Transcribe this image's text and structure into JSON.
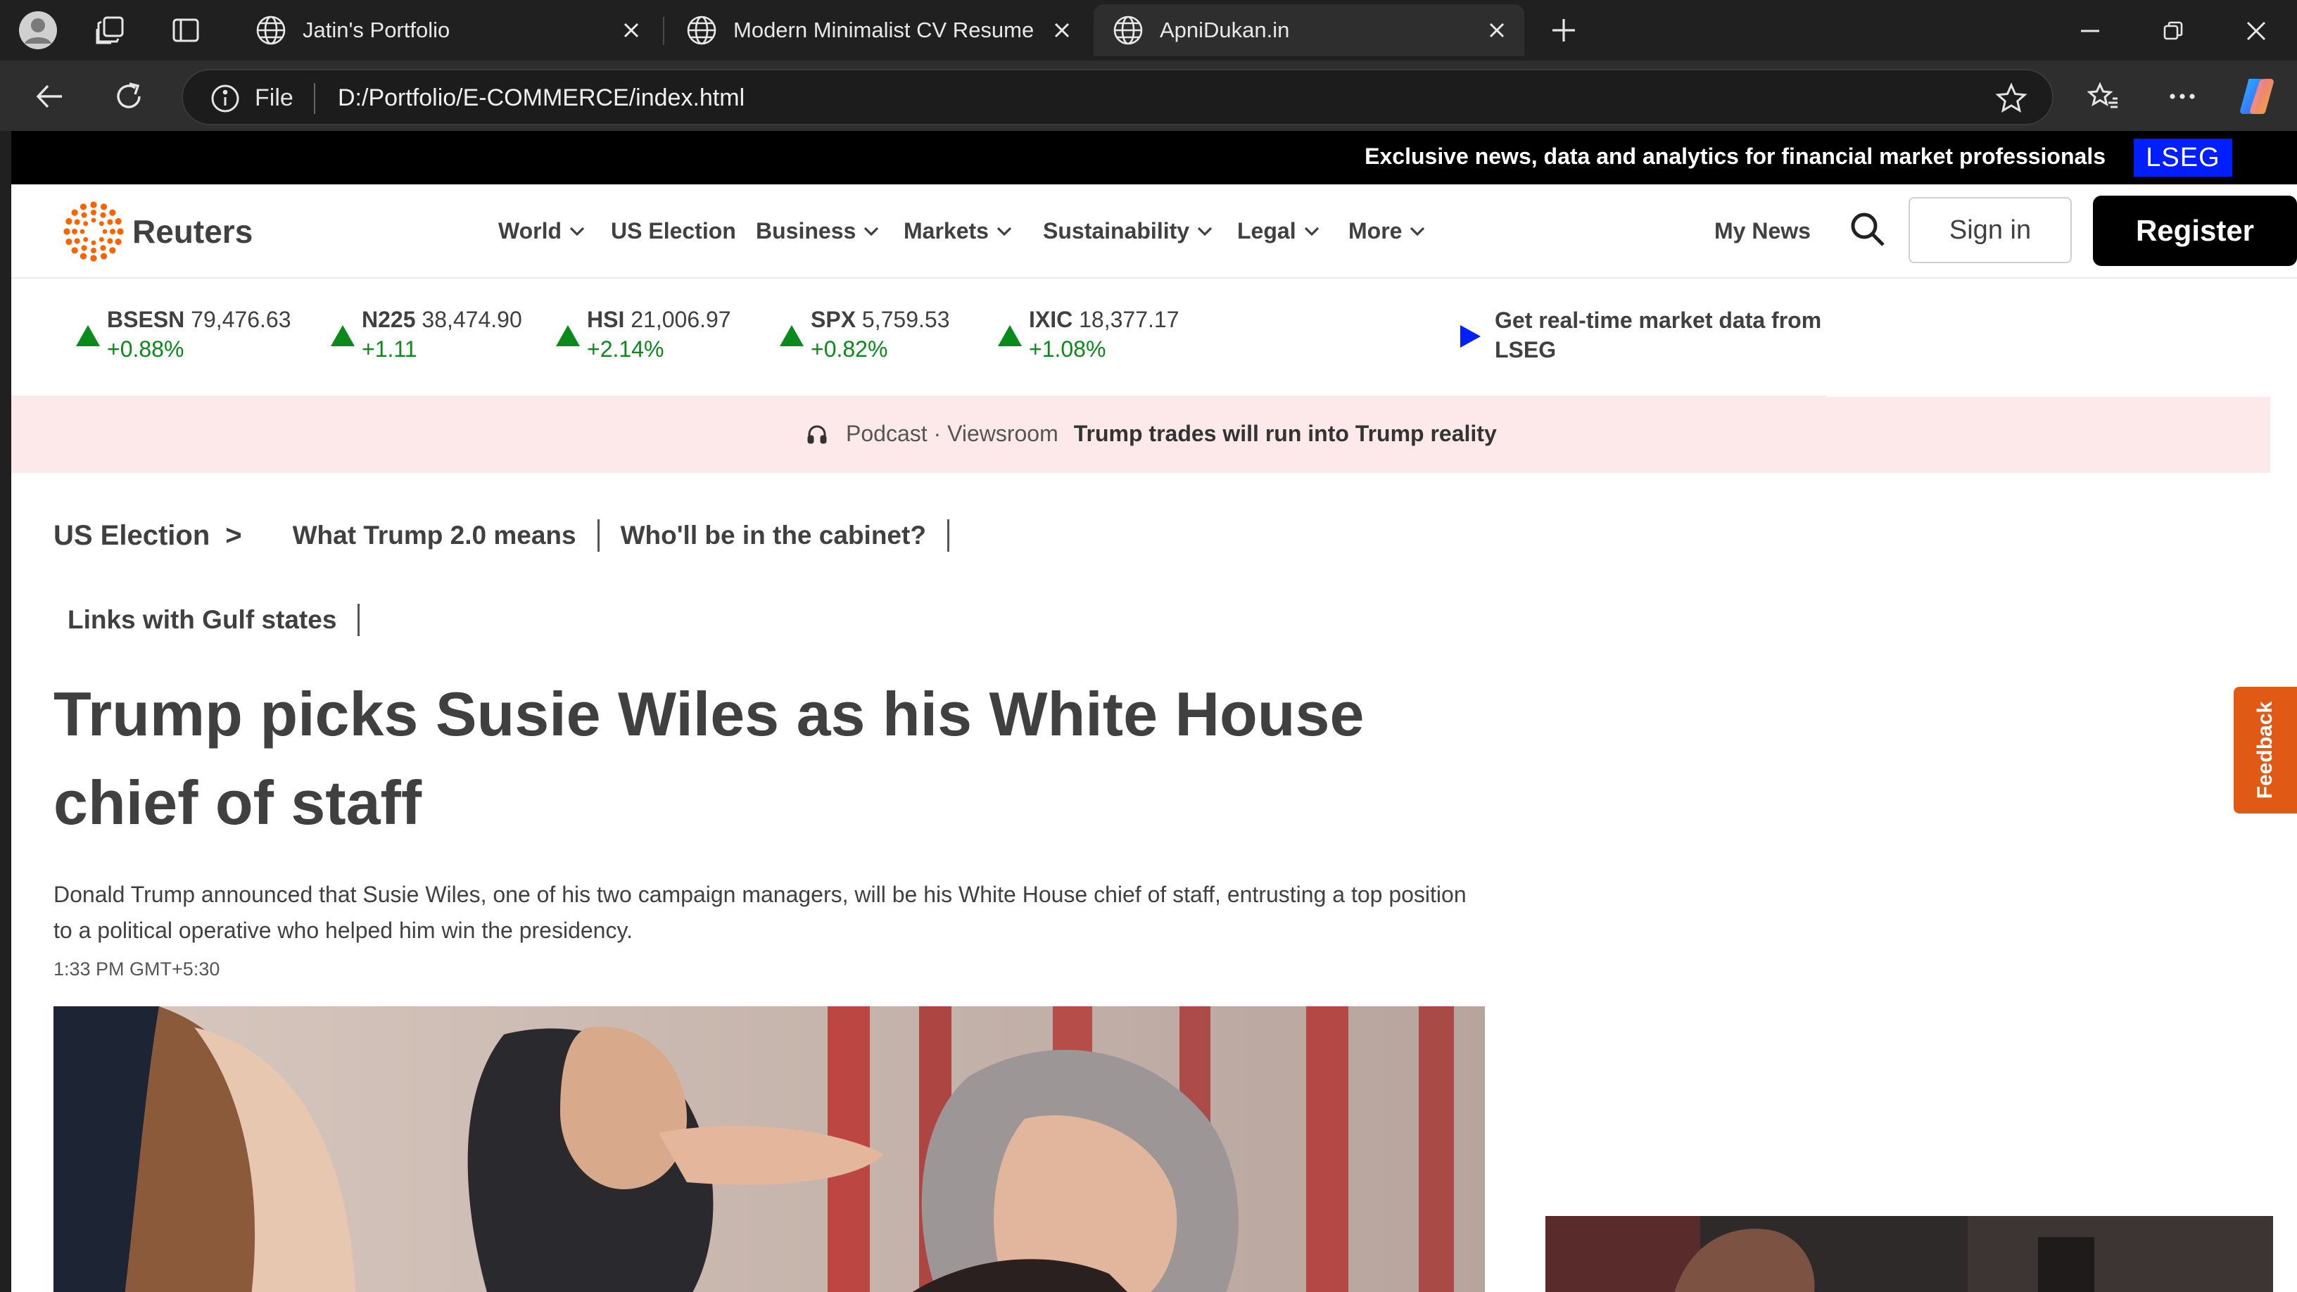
{
  "browser": {
    "tabs": [
      {
        "title": "Jatin's Portfolio",
        "active": false
      },
      {
        "title": "Modern Minimalist CV Resume",
        "active": false
      },
      {
        "title": "ApniDukan.in",
        "active": true
      }
    ],
    "address": {
      "scheme_label": "File",
      "url": "D:/Portfolio/E-COMMERCE/index.html"
    }
  },
  "page": {
    "promo": {
      "text": "Exclusive news, data and analytics for financial market professionals",
      "badge": "LSEG"
    },
    "site": {
      "brand": "Reuters",
      "accent": "#fa6400"
    },
    "nav": {
      "items": [
        {
          "label": "World",
          "dropdown": true
        },
        {
          "label": "US Election",
          "dropdown": false
        },
        {
          "label": "Business",
          "dropdown": true
        },
        {
          "label": "Markets",
          "dropdown": true
        },
        {
          "label": "Sustainability",
          "dropdown": true
        },
        {
          "label": "Legal",
          "dropdown": true
        },
        {
          "label": "More",
          "dropdown": true
        }
      ],
      "my_news": "My News",
      "sign_in": "Sign in",
      "register": "Register"
    },
    "ticker": [
      {
        "symbol": "BSESN",
        "value": "79,476.63",
        "change": "+0.88%",
        "direction": "up"
      },
      {
        "symbol": "N225",
        "value": "38,474.90",
        "change": "+1.11",
        "direction": "up"
      },
      {
        "symbol": "HSI",
        "value": "21,006.97",
        "change": "+2.14%",
        "direction": "up"
      },
      {
        "symbol": "SPX",
        "value": "5,759.53",
        "change": "+0.82%",
        "direction": "up"
      },
      {
        "symbol": "IXIC",
        "value": "18,377.17",
        "change": "+1.08%",
        "direction": "up"
      }
    ],
    "lseg_promo": "Get real-time market data from LSEG",
    "podcast": {
      "label": "Podcast · Viewsroom",
      "title": "Trump trades will run into Trump reality"
    },
    "breadcrumb": {
      "section": "US Election",
      "arrow": ">",
      "links": [
        "What Trump 2.0 means",
        "Who'll be in the cabinet?",
        "Links with Gulf states"
      ]
    },
    "article": {
      "headline": "Trump picks Susie Wiles as his White House chief of staff",
      "summary": "Donald Trump announced that Susie Wiles, one of his two campaign managers, will be his White House chief of staff, entrusting a top position to a political operative who helped him win the presidency.",
      "timestamp": "1:33 PM GMT+5:30"
    },
    "feedback": "Feedback",
    "colors": {
      "up": "#0a8a1a",
      "lseg": "#001eff",
      "podcast_bg": "#fde8ea",
      "feedback": "#e05a15"
    }
  }
}
